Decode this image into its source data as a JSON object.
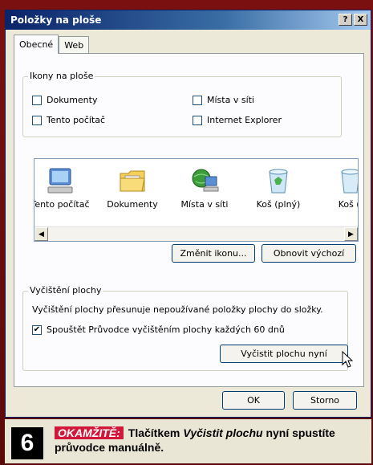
{
  "window": {
    "title": "Položky na ploše",
    "help_btn": "?",
    "close_btn": "X"
  },
  "tabs": [
    {
      "label": "Obecné",
      "active": true
    },
    {
      "label": "Web",
      "active": false
    }
  ],
  "desktop_icons_group": {
    "label": "Ikony na ploše",
    "checkboxes": [
      {
        "label": "Dokumenty",
        "checked": false
      },
      {
        "label": "Místa v síti",
        "checked": false
      },
      {
        "label": "Tento počítač",
        "checked": false
      },
      {
        "label": "Internet Explorer",
        "checked": false
      }
    ]
  },
  "icon_list": [
    {
      "label": "Tento počítač",
      "icon": "computer-icon"
    },
    {
      "label": "Dokumenty",
      "icon": "documents-folder-icon"
    },
    {
      "label": "Místa v síti",
      "icon": "network-places-icon"
    },
    {
      "label": "Koš (plný)",
      "icon": "recycle-bin-full-icon"
    },
    {
      "label": "Koš (|",
      "icon": "recycle-bin-empty-icon"
    }
  ],
  "buttons": {
    "change_icon": "Změnit ikonu...",
    "restore_default": "Obnovit výchozí",
    "clean_now": "Vyčistit plochu nyní",
    "ok": "OK",
    "cancel": "Storno"
  },
  "cleanup_group": {
    "label": "Vyčištění plochy",
    "description": "Vyčištění plochy přesunuje nepoužívané položky plochy do složky.",
    "checkbox_label": "Spouštět Průvodce vyčištěním plochy každých 60 dnů",
    "checkbox_checked": true
  },
  "caption": {
    "number": "6",
    "keyword": "OKAMŽITĚ:",
    "text_part1": "Tlačítkem ",
    "text_italic": "Vyčistit plochu",
    "text_part2": " nyní spustíte průvodce manuálně."
  },
  "colors": {
    "title_bar": "#0a246a",
    "frame": "#6a0c0c",
    "caption_keyword": "#d3173a"
  }
}
